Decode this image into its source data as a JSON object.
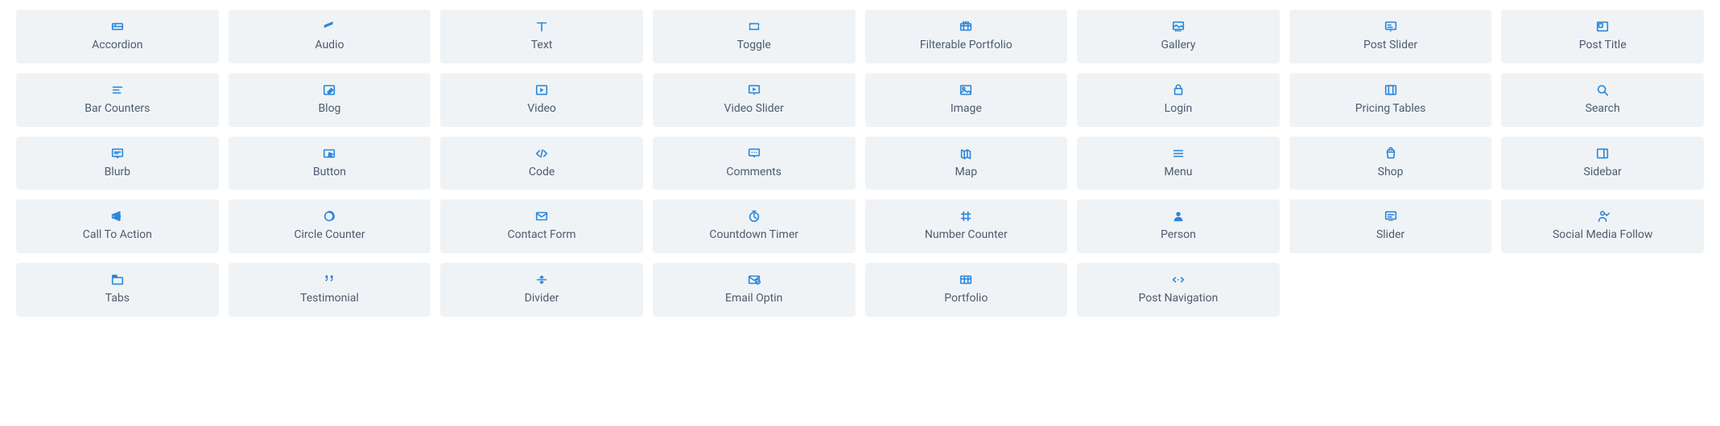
{
  "colors": {
    "icon": "#2b87da",
    "label": "#4d5c6d",
    "tile_bg": "#f0f3f6"
  },
  "modules": [
    {
      "id": "accordion",
      "label": "Accordion",
      "icon": "accordion"
    },
    {
      "id": "audio",
      "label": "Audio",
      "icon": "audio"
    },
    {
      "id": "text",
      "label": "Text",
      "icon": "text"
    },
    {
      "id": "toggle",
      "label": "Toggle",
      "icon": "toggle"
    },
    {
      "id": "filterable-portfolio",
      "label": "Filterable Portfolio",
      "icon": "filterable-portfolio"
    },
    {
      "id": "gallery",
      "label": "Gallery",
      "icon": "gallery"
    },
    {
      "id": "post-slider",
      "label": "Post Slider",
      "icon": "post-slider"
    },
    {
      "id": "post-title",
      "label": "Post Title",
      "icon": "post-title"
    },
    {
      "id": "bar-counters",
      "label": "Bar Counters",
      "icon": "bar-counters"
    },
    {
      "id": "blog",
      "label": "Blog",
      "icon": "blog"
    },
    {
      "id": "video",
      "label": "Video",
      "icon": "video"
    },
    {
      "id": "video-slider",
      "label": "Video Slider",
      "icon": "video-slider"
    },
    {
      "id": "image",
      "label": "Image",
      "icon": "image"
    },
    {
      "id": "login",
      "label": "Login",
      "icon": "login"
    },
    {
      "id": "pricing-tables",
      "label": "Pricing Tables",
      "icon": "pricing-tables"
    },
    {
      "id": "search",
      "label": "Search",
      "icon": "search"
    },
    {
      "id": "blurb",
      "label": "Blurb",
      "icon": "blurb"
    },
    {
      "id": "button",
      "label": "Button",
      "icon": "button"
    },
    {
      "id": "code",
      "label": "Code",
      "icon": "code"
    },
    {
      "id": "comments",
      "label": "Comments",
      "icon": "comments"
    },
    {
      "id": "map",
      "label": "Map",
      "icon": "map"
    },
    {
      "id": "menu",
      "label": "Menu",
      "icon": "menu"
    },
    {
      "id": "shop",
      "label": "Shop",
      "icon": "shop"
    },
    {
      "id": "sidebar",
      "label": "Sidebar",
      "icon": "sidebar"
    },
    {
      "id": "call-to-action",
      "label": "Call To Action",
      "icon": "call-to-action"
    },
    {
      "id": "circle-counter",
      "label": "Circle Counter",
      "icon": "circle-counter"
    },
    {
      "id": "contact-form",
      "label": "Contact Form",
      "icon": "contact-form"
    },
    {
      "id": "countdown-timer",
      "label": "Countdown Timer",
      "icon": "countdown-timer"
    },
    {
      "id": "number-counter",
      "label": "Number Counter",
      "icon": "number-counter"
    },
    {
      "id": "person",
      "label": "Person",
      "icon": "person"
    },
    {
      "id": "slider",
      "label": "Slider",
      "icon": "slider"
    },
    {
      "id": "social-media-follow",
      "label": "Social Media Follow",
      "icon": "social-media-follow"
    },
    {
      "id": "tabs",
      "label": "Tabs",
      "icon": "tabs"
    },
    {
      "id": "testimonial",
      "label": "Testimonial",
      "icon": "testimonial"
    },
    {
      "id": "divider",
      "label": "Divider",
      "icon": "divider"
    },
    {
      "id": "email-optin",
      "label": "Email Optin",
      "icon": "email-optin"
    },
    {
      "id": "portfolio",
      "label": "Portfolio",
      "icon": "portfolio"
    },
    {
      "id": "post-navigation",
      "label": "Post Navigation",
      "icon": "post-navigation"
    }
  ]
}
